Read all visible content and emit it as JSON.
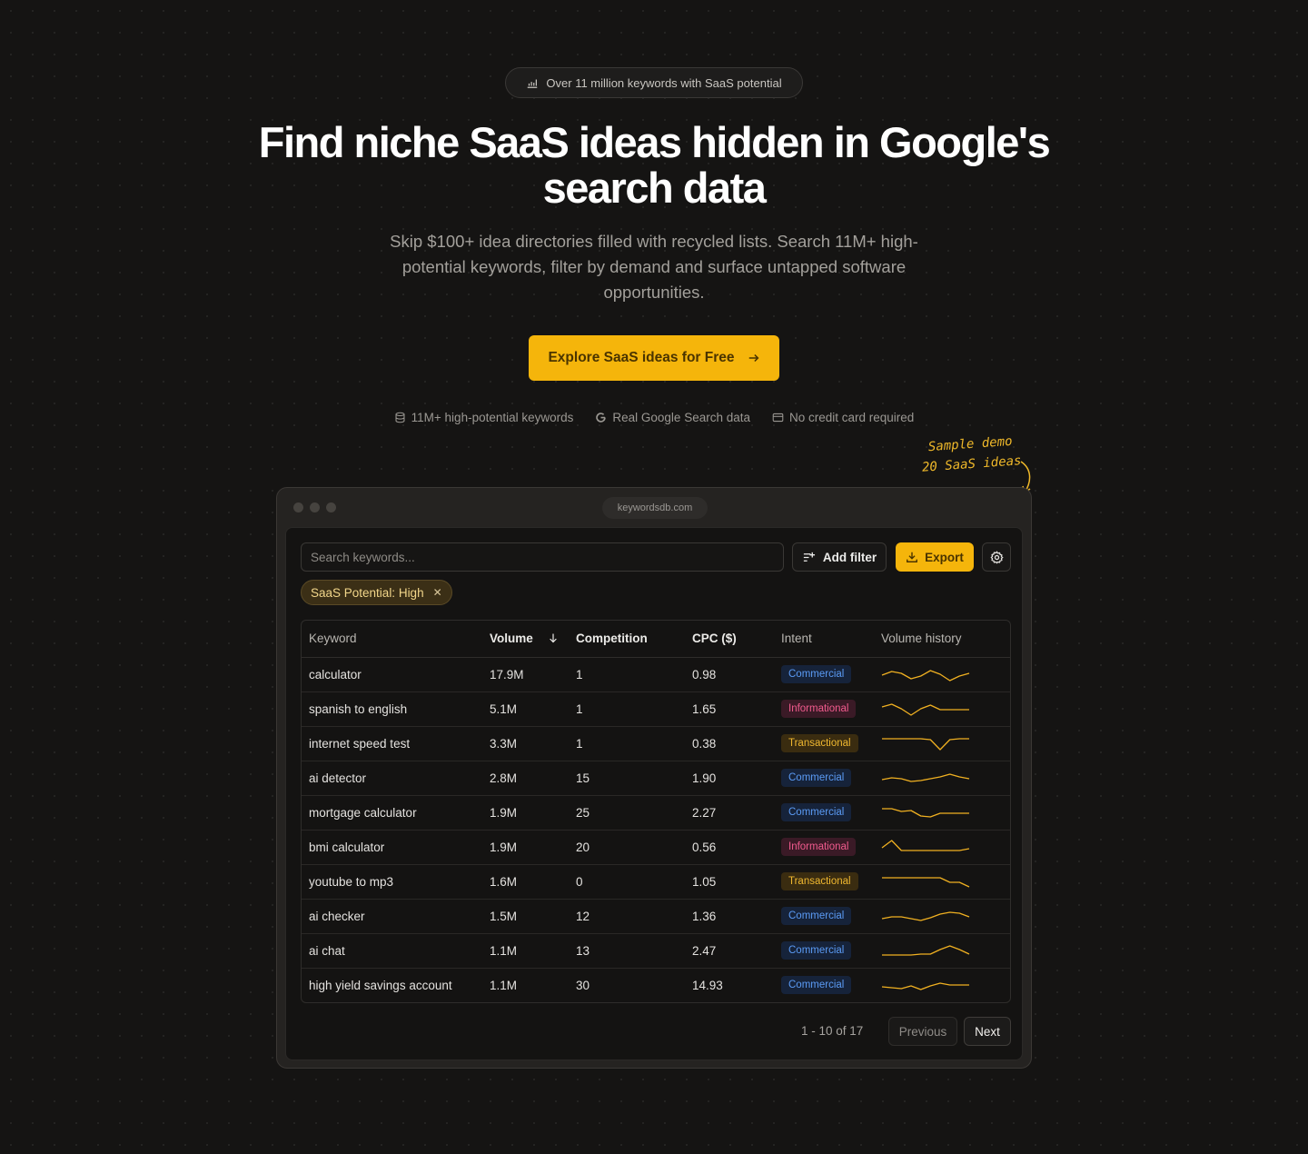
{
  "hero": {
    "badge": "Over 11 million keywords with SaaS potential",
    "title": "Find niche SaaS ideas hidden in Google's search data",
    "subtitle": "Skip $100+ idea directories filled with recycled lists. Search 11M+ high-potential keywords, filter by demand and surface untapped software opportunities.",
    "cta_label": "Explore SaaS ideas for Free",
    "features": [
      {
        "icon": "database-icon",
        "label": "11M+ high-potential keywords"
      },
      {
        "icon": "google-icon",
        "label": "Real Google Search data"
      },
      {
        "icon": "credit-card-icon",
        "label": "No credit card required"
      }
    ],
    "demo_note_line1": "Sample demo",
    "demo_note_line2": "20 SaaS ideas"
  },
  "browser": {
    "url": "keywordsdb.com"
  },
  "app": {
    "search_placeholder": "Search keywords...",
    "add_filter_label": "Add filter",
    "export_label": "Export",
    "active_filter": "SaaS Potential: High",
    "columns": {
      "keyword": "Keyword",
      "volume": "Volume",
      "competition": "Competition",
      "cpc": "CPC ($)",
      "intent": "Intent",
      "history": "Volume history"
    },
    "rows": [
      {
        "keyword": "calculator",
        "volume": "17.9M",
        "competition": "1",
        "cpc": "0.98",
        "intent": "Commercial",
        "history": [
          0.55,
          0.35,
          0.45,
          0.75,
          0.6,
          0.3,
          0.5,
          0.85,
          0.6,
          0.45
        ]
      },
      {
        "keyword": "spanish to english",
        "volume": "5.1M",
        "competition": "1",
        "cpc": "1.65",
        "intent": "Informational",
        "history": [
          0.4,
          0.25,
          0.5,
          0.85,
          0.5,
          0.3,
          0.55,
          0.55,
          0.55,
          0.55
        ]
      },
      {
        "keyword": "internet speed test",
        "volume": "3.3M",
        "competition": "1",
        "cpc": "0.38",
        "intent": "Transactional",
        "history": [
          0.25,
          0.25,
          0.25,
          0.25,
          0.25,
          0.3,
          0.85,
          0.3,
          0.25,
          0.25
        ]
      },
      {
        "keyword": "ai detector",
        "volume": "2.8M",
        "competition": "15",
        "cpc": "1.90",
        "intent": "Commercial",
        "history": [
          0.6,
          0.5,
          0.55,
          0.7,
          0.65,
          0.55,
          0.45,
          0.3,
          0.45,
          0.55
        ]
      },
      {
        "keyword": "mortgage calculator",
        "volume": "1.9M",
        "competition": "25",
        "cpc": "2.27",
        "intent": "Commercial",
        "history": [
          0.3,
          0.3,
          0.45,
          0.4,
          0.7,
          0.75,
          0.55,
          0.55,
          0.55,
          0.55
        ]
      },
      {
        "keyword": "bmi calculator",
        "volume": "1.9M",
        "competition": "20",
        "cpc": "0.56",
        "intent": "Informational",
        "history": [
          0.55,
          0.15,
          0.7,
          0.7,
          0.7,
          0.7,
          0.7,
          0.7,
          0.7,
          0.6
        ]
      },
      {
        "keyword": "youtube to mp3",
        "volume": "1.6M",
        "competition": "0",
        "cpc": "1.05",
        "intent": "Transactional",
        "history": [
          0.3,
          0.3,
          0.3,
          0.3,
          0.3,
          0.3,
          0.3,
          0.55,
          0.55,
          0.8
        ]
      },
      {
        "keyword": "ai checker",
        "volume": "1.5M",
        "competition": "12",
        "cpc": "1.36",
        "intent": "Commercial",
        "history": [
          0.65,
          0.55,
          0.55,
          0.65,
          0.75,
          0.6,
          0.4,
          0.3,
          0.35,
          0.55
        ]
      },
      {
        "keyword": "ai chat",
        "volume": "1.1M",
        "competition": "13",
        "cpc": "2.47",
        "intent": "Commercial",
        "history": [
          0.75,
          0.75,
          0.75,
          0.75,
          0.7,
          0.7,
          0.45,
          0.25,
          0.45,
          0.7
        ]
      },
      {
        "keyword": "high yield savings account",
        "volume": "1.1M",
        "competition": "30",
        "cpc": "14.93",
        "intent": "Commercial",
        "history": [
          0.6,
          0.65,
          0.7,
          0.55,
          0.75,
          0.55,
          0.4,
          0.5,
          0.5,
          0.5
        ]
      }
    ],
    "pagination": {
      "info": "1 - 10 of 17",
      "previous": "Previous",
      "next": "Next"
    }
  },
  "colors": {
    "accent": "#f5b50b",
    "sparkline": "#f0b021",
    "commercial": "#5b9bf5",
    "informational": "#f25b8e",
    "transactional": "#f0b830"
  }
}
